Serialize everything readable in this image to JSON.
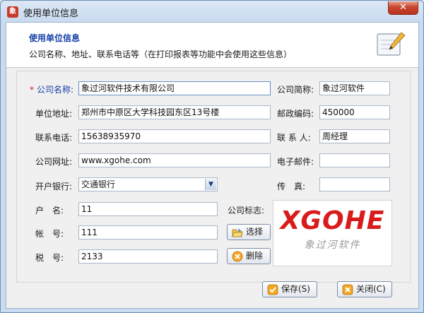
{
  "window": {
    "title": "使用单位信息",
    "icon_text": "象",
    "close_symbol": "✕"
  },
  "header": {
    "title": "使用单位信息",
    "description": "公司名称、地址、联系电话等（在打印报表等功能中会使用这些信息）",
    "icon": "notepad-pencil-icon"
  },
  "form": {
    "required_marker": "*",
    "company_name": {
      "label": "公司名称:",
      "value": "象过河软件技术有限公司"
    },
    "company_short": {
      "label": "公司简称:",
      "value": "象过河软件"
    },
    "address": {
      "label": "单位地址:",
      "value": "郑州市中原区大学科技园东区13号楼"
    },
    "postcode": {
      "label": "邮政编码:",
      "value": "450000"
    },
    "phone": {
      "label": "联系电话:",
      "value": "15638935970"
    },
    "contact": {
      "label": "联 系 人:",
      "value": "周经理"
    },
    "website": {
      "label": "公司网址:",
      "value": "www.xgohe.com"
    },
    "email": {
      "label": "电子邮件:",
      "value": ""
    },
    "bank": {
      "label": "开户银行:",
      "value": "交通银行"
    },
    "fax": {
      "label": "传　真:",
      "value": ""
    },
    "account_name": {
      "label": "户　名:",
      "value": "11"
    },
    "account_no": {
      "label": "帐　号:",
      "value": "111"
    },
    "tax_no": {
      "label": "税　号:",
      "value": "2133"
    },
    "logo_label": "公司标志:",
    "logo": {
      "brand": "XGOHE",
      "subtitle": "象过河软件"
    },
    "select_button": "选择",
    "delete_button": "删除"
  },
  "footer": {
    "save_button": "保存(S)",
    "close_button": "关闭(C)"
  }
}
